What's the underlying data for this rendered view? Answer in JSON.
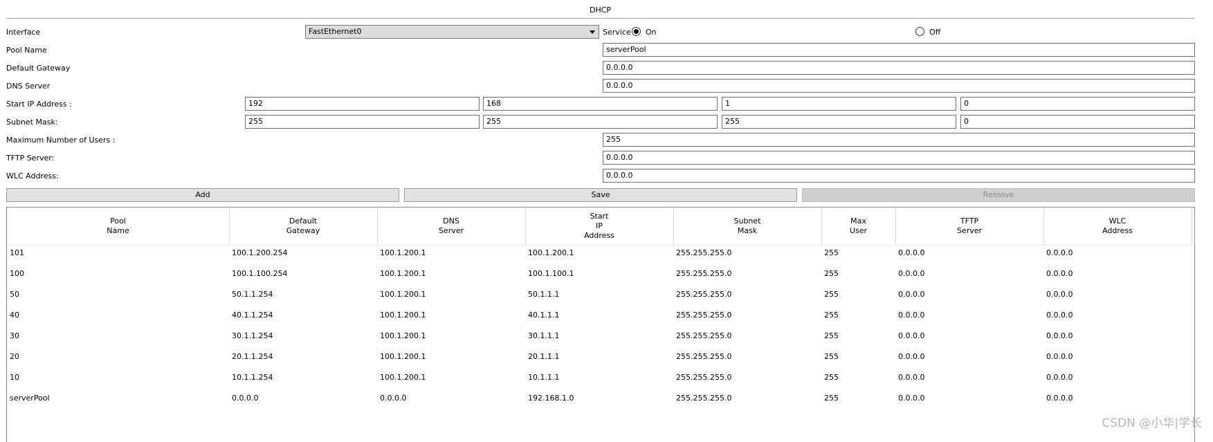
{
  "title": "DHCP",
  "interface": {
    "label": "Interface",
    "value": "FastEthernet0"
  },
  "service": {
    "label": "Service",
    "on_label": "On",
    "off_label": "Off",
    "selected": "On"
  },
  "pool_name": {
    "label": "Pool Name",
    "value": "serverPool"
  },
  "default_gateway": {
    "label": "Default Gateway",
    "value": "0.0.0.0"
  },
  "dns_server": {
    "label": "DNS Server",
    "value": "0.0.0.0"
  },
  "start_ip": {
    "label": "Start IP Address :",
    "octets": [
      "192",
      "168",
      "1",
      "0"
    ]
  },
  "subnet_mask": {
    "label": "Subnet Mask:",
    "octets": [
      "255",
      "255",
      "255",
      "0"
    ]
  },
  "max_users": {
    "label": "Maximum Number of Users :",
    "value": "255"
  },
  "tftp_server": {
    "label": "TFTP Server:",
    "value": "0.0.0.0"
  },
  "wlc_address": {
    "label": "WLC Address:",
    "value": "0.0.0.0"
  },
  "buttons": {
    "add": "Add",
    "save": "Save",
    "remove": "Remove"
  },
  "table": {
    "columns": [
      "Pool\nName",
      "Default\nGateway",
      "DNS\nServer",
      "Start\nIP\nAddress",
      "Subnet\nMask",
      "Max\nUser",
      "TFTP\nServer",
      "WLC\nAddress"
    ],
    "rows": [
      [
        "101",
        "100.1.200.254",
        "100.1.200.1",
        "100.1.200.1",
        "255.255.255.0",
        "255",
        "0.0.0.0",
        "0.0.0.0"
      ],
      [
        "100",
        "100.1.100.254",
        "100.1.200.1",
        "100.1.100.1",
        "255.255.255.0",
        "255",
        "0.0.0.0",
        "0.0.0.0"
      ],
      [
        "50",
        "50.1.1.254",
        "100.1.200.1",
        "50.1.1.1",
        "255.255.255.0",
        "255",
        "0.0.0.0",
        "0.0.0.0"
      ],
      [
        "40",
        "40.1.1.254",
        "100.1.200.1",
        "40.1.1.1",
        "255.255.255.0",
        "255",
        "0.0.0.0",
        "0.0.0.0"
      ],
      [
        "30",
        "30.1.1.254",
        "100.1.200.1",
        "30.1.1.1",
        "255.255.255.0",
        "255",
        "0.0.0.0",
        "0.0.0.0"
      ],
      [
        "20",
        "20.1.1.254",
        "100.1.200.1",
        "20.1.1.1",
        "255.255.255.0",
        "255",
        "0.0.0.0",
        "0.0.0.0"
      ],
      [
        "10",
        "10.1.1.254",
        "100.1.200.1",
        "10.1.1.1",
        "255.255.255.0",
        "255",
        "0.0.0.0",
        "0.0.0.0"
      ],
      [
        "serverPool",
        "0.0.0.0",
        "0.0.0.0",
        "192.168.1.0",
        "255.255.255.0",
        "255",
        "0.0.0.0",
        "0.0.0.0"
      ]
    ]
  },
  "watermark": "CSDN @小华|学长"
}
